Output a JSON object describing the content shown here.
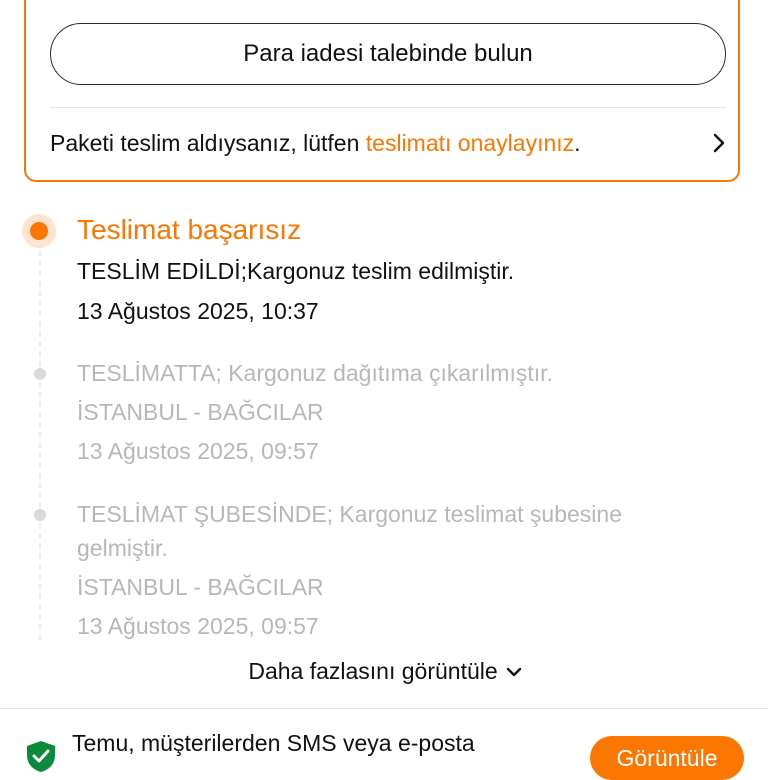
{
  "refund": {
    "button_label": "Para iadesi talebinde bulun",
    "confirm_prefix": "Paketi teslim aldıysanız, lütfen ",
    "confirm_link": "teslimatı onaylayınız",
    "confirm_suffix": "."
  },
  "timeline": {
    "active": {
      "title": "Teslimat başarısız",
      "message": "TESLİM EDİLDİ;Kargonuz teslim edilmiştir.",
      "time": "13 Ağustos 2025, 10:37"
    },
    "events": [
      {
        "message": "TESLİMATTA; Kargonuz dağıtıma çıkarılmıştır.",
        "location": "İSTANBUL - BAĞCILAR",
        "time": "13 Ağustos 2025, 09:57"
      },
      {
        "message": "TESLİMAT ŞUBESİNDE; Kargonuz teslimat şubesine gelmiştir.",
        "location": "İSTANBUL - BAĞCILAR",
        "time": "13 Ağustos 2025, 09:57"
      }
    ],
    "more_label": "Daha fazlasını görüntüle"
  },
  "footer": {
    "notice_text": "Temu, müşterilerden SMS veya e-posta",
    "view_button": "Görüntüle"
  },
  "colors": {
    "accent": "#fb7701",
    "muted_text": "#b7b7b7"
  },
  "icons": {
    "confirm_chevron": "chevron-right-icon",
    "more_chevron": "chevron-down-icon",
    "shield": "shield-check-icon"
  }
}
